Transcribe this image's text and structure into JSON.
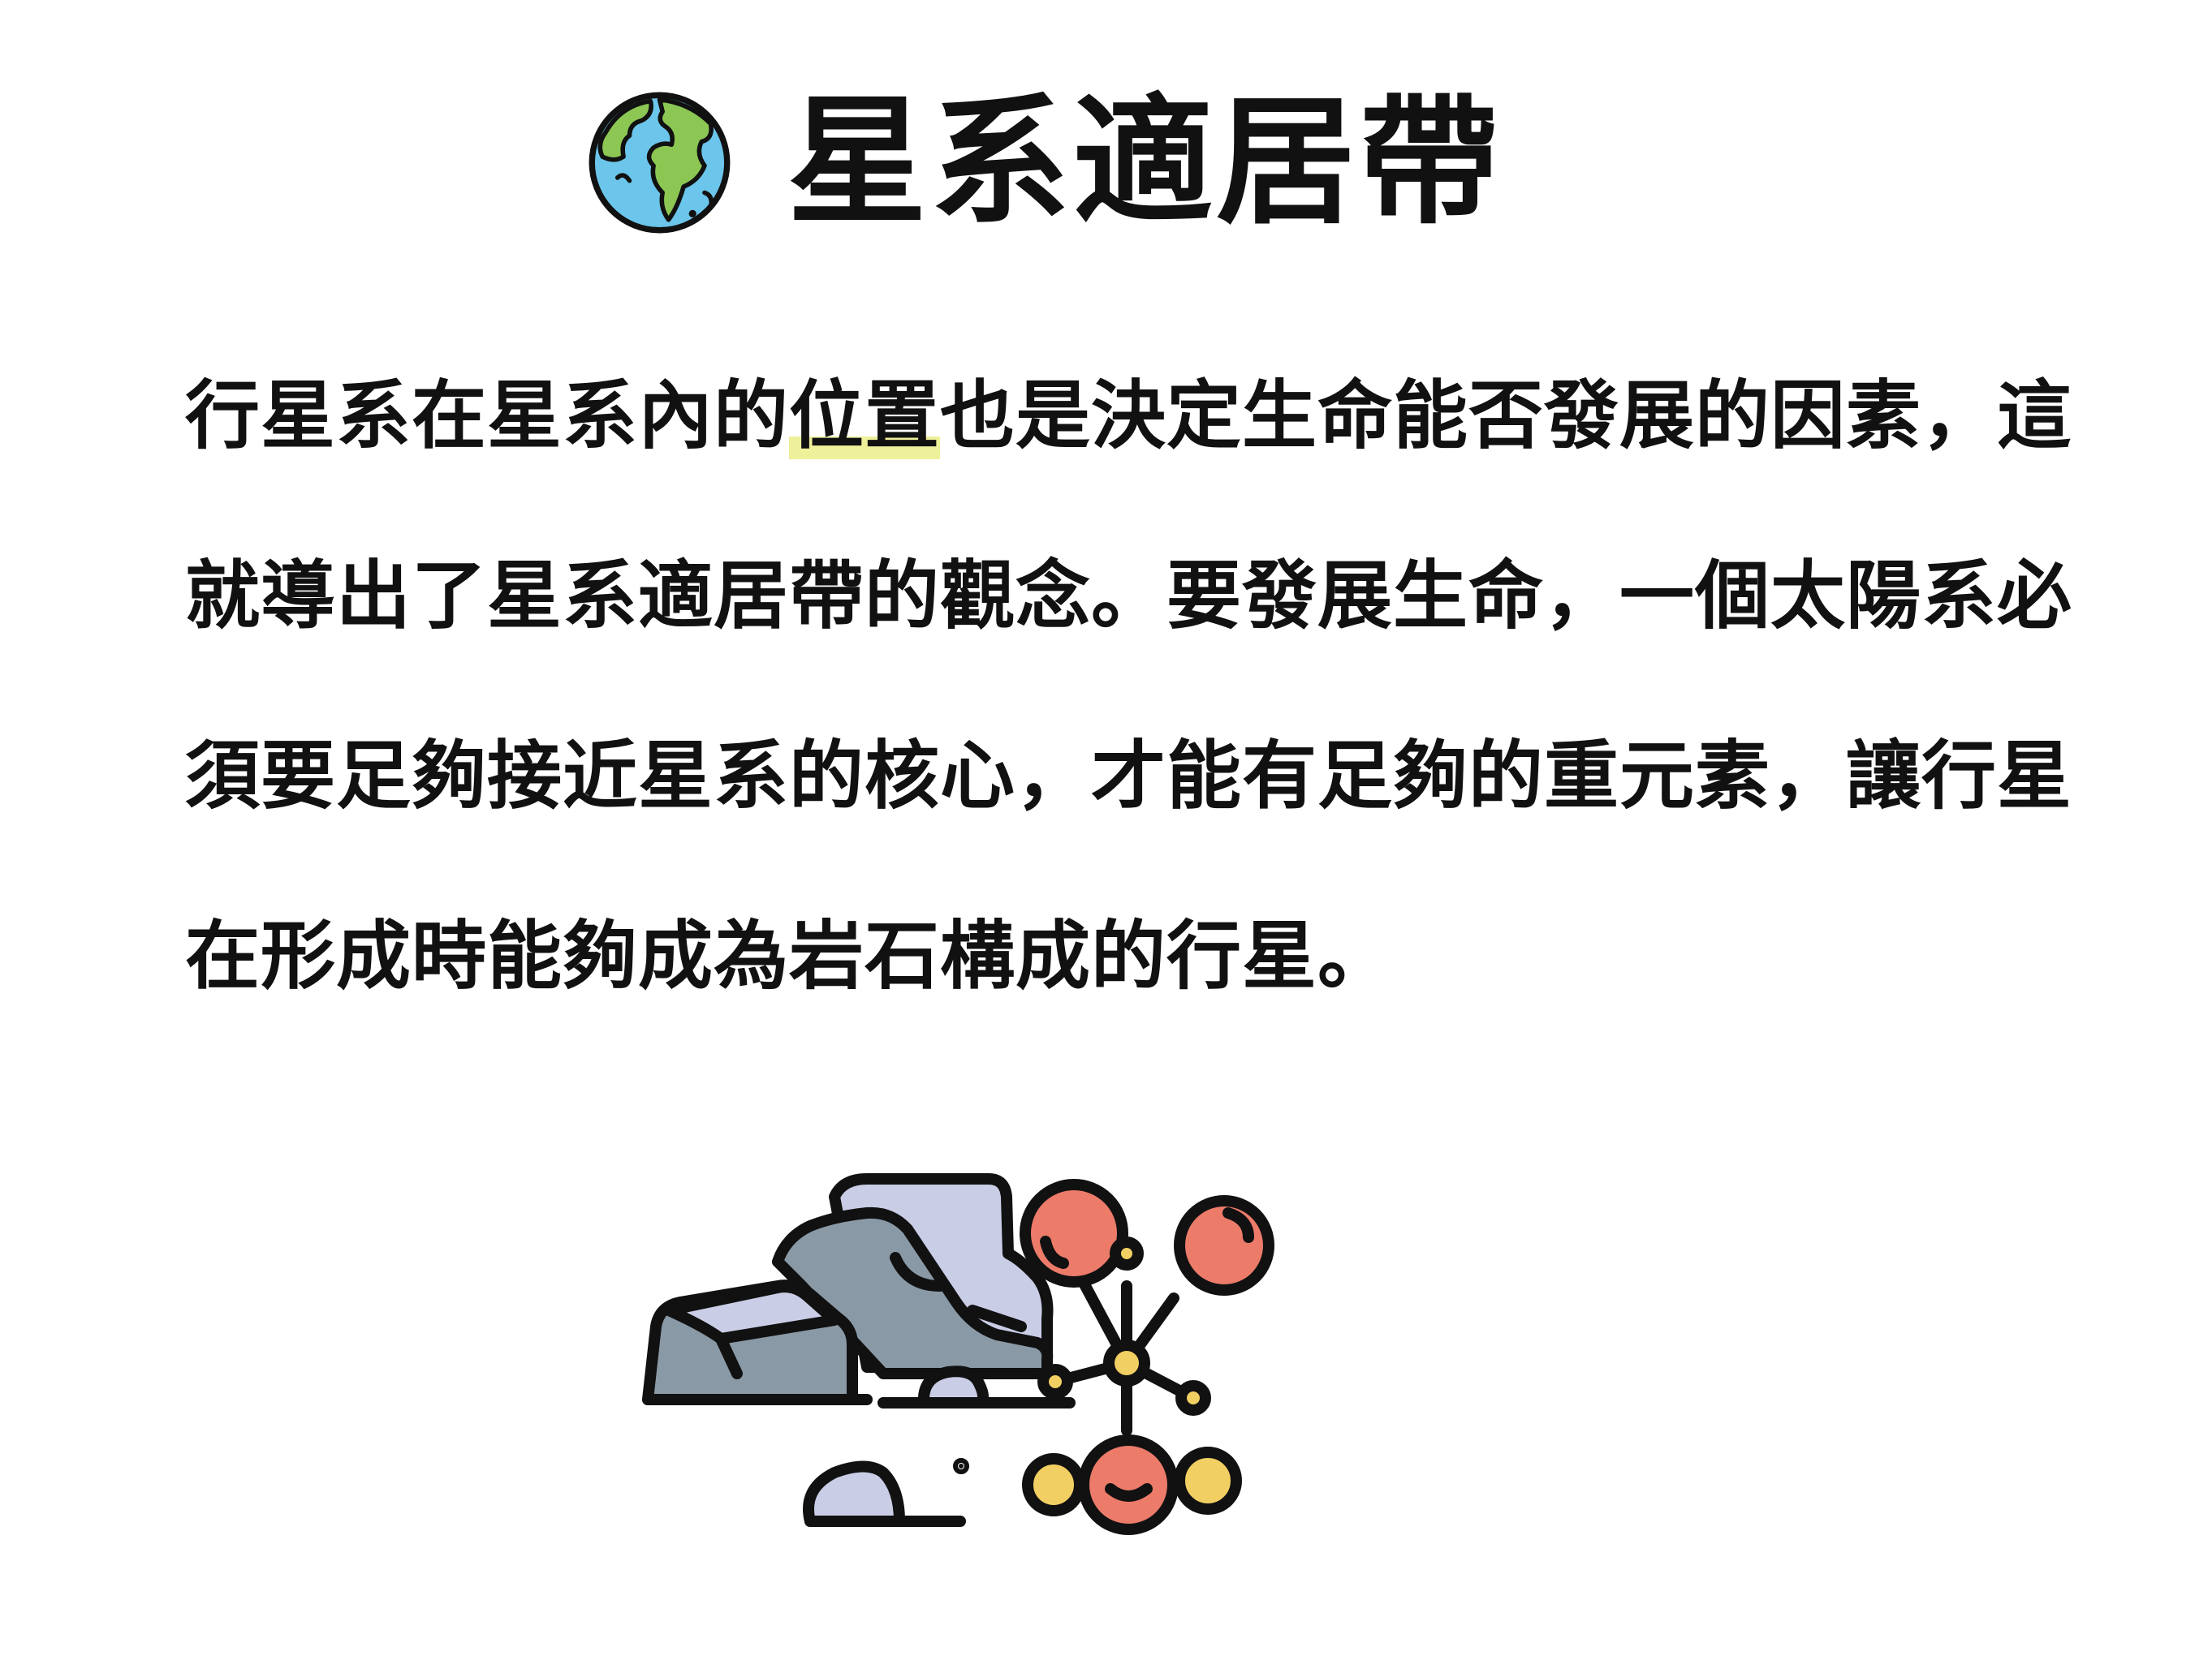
{
  "header": {
    "icon": "earth-globe-icon",
    "title": "星系適居帶"
  },
  "paragraph": {
    "lines": [
      {
        "before": "行星系在星系內的",
        "highlight": "位置",
        "after": "也是決定生命能否發展的因素，這"
      },
      {
        "text": "就導出了星系適居帶的觀念。要發展生命，一個太陽系必"
      },
      {
        "text": "須要足夠接近星系的核心，才能有足夠的重元素，讓行星"
      },
      {
        "text": "在形成時能夠成為岩石構成的行星。"
      }
    ],
    "highlight_color": "#eef09a"
  },
  "illustrations": {
    "left": "rocks-icon",
    "right": "molecule-icon"
  },
  "colors": {
    "text": "#111111",
    "rock_dark": "#8a99a6",
    "rock_light": "#c9cde6",
    "atom_red": "#ec7b6a",
    "atom_yellow": "#f2cf63",
    "globe_blue": "#6cc5ea",
    "globe_green": "#8cc754"
  }
}
